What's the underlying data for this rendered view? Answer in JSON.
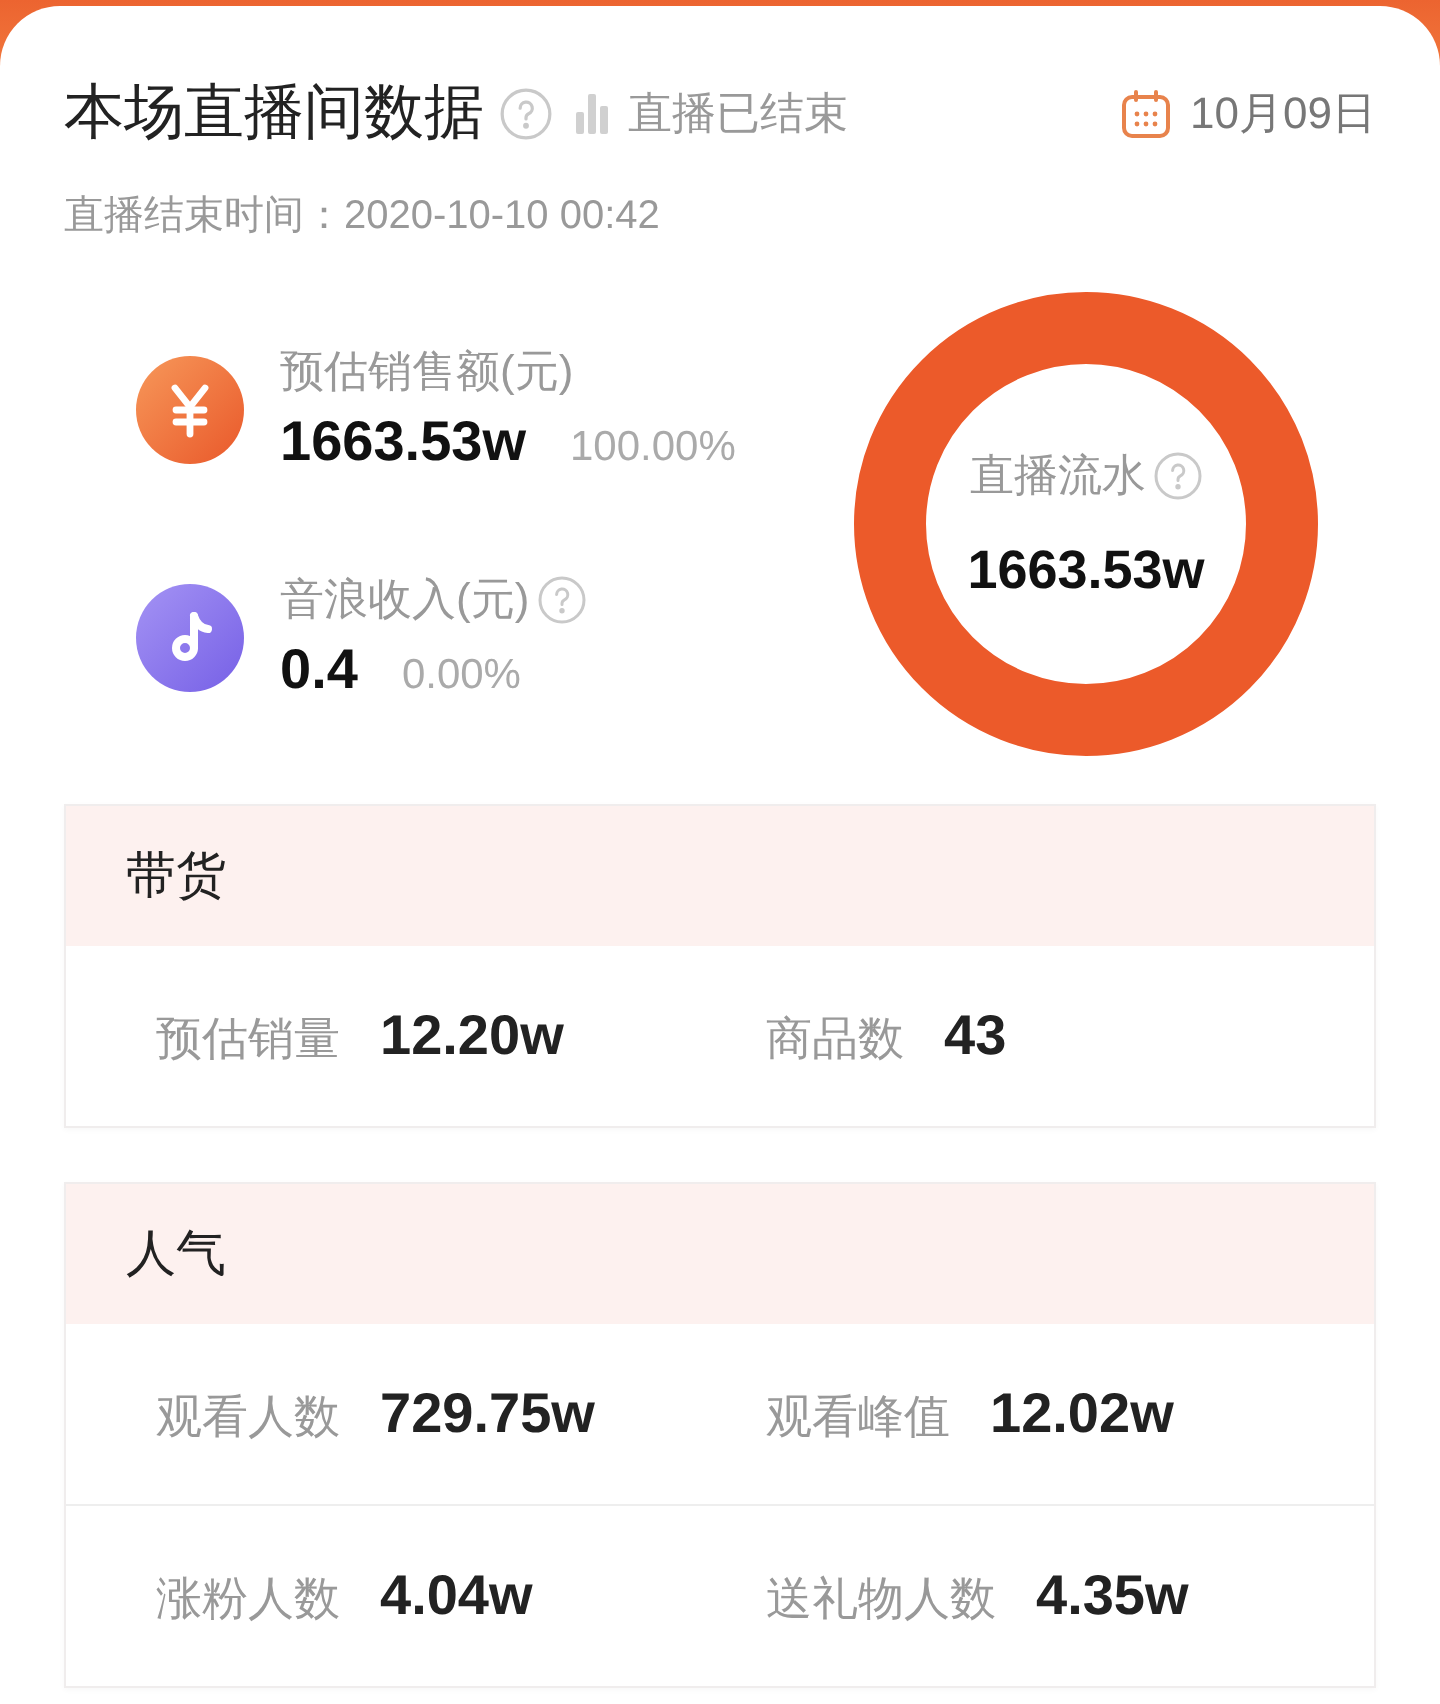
{
  "header": {
    "title": "本场直播间数据",
    "status": "直播已结束",
    "date": "10月09日"
  },
  "end_time": "直播结束时间：2020-10-10 00:42",
  "revenue_items": [
    {
      "kind": "yen",
      "label": "预估销售额(元)",
      "help": false,
      "value": "1663.53w",
      "share": "100.00%"
    },
    {
      "kind": "note",
      "label": "音浪收入(元)",
      "help": true,
      "value": "0.4",
      "share": "0.00%"
    }
  ],
  "donut": {
    "label": "直播流水",
    "value": "1663.53w"
  },
  "sections": [
    {
      "title": "带货",
      "rows": [
        {
          "metrics": [
            {
              "label": "预估销量",
              "value": "12.20w"
            },
            {
              "label": "商品数",
              "value": "43"
            }
          ]
        }
      ]
    },
    {
      "title": "人气",
      "rows": [
        {
          "metrics": [
            {
              "label": "观看人数",
              "value": "729.75w"
            },
            {
              "label": "观看峰值",
              "value": "12.02w"
            }
          ]
        },
        {
          "metrics": [
            {
              "label": "涨粉人数",
              "value": "4.04w"
            },
            {
              "label": "送礼物人数",
              "value": "4.35w"
            }
          ]
        }
      ]
    }
  ]
}
